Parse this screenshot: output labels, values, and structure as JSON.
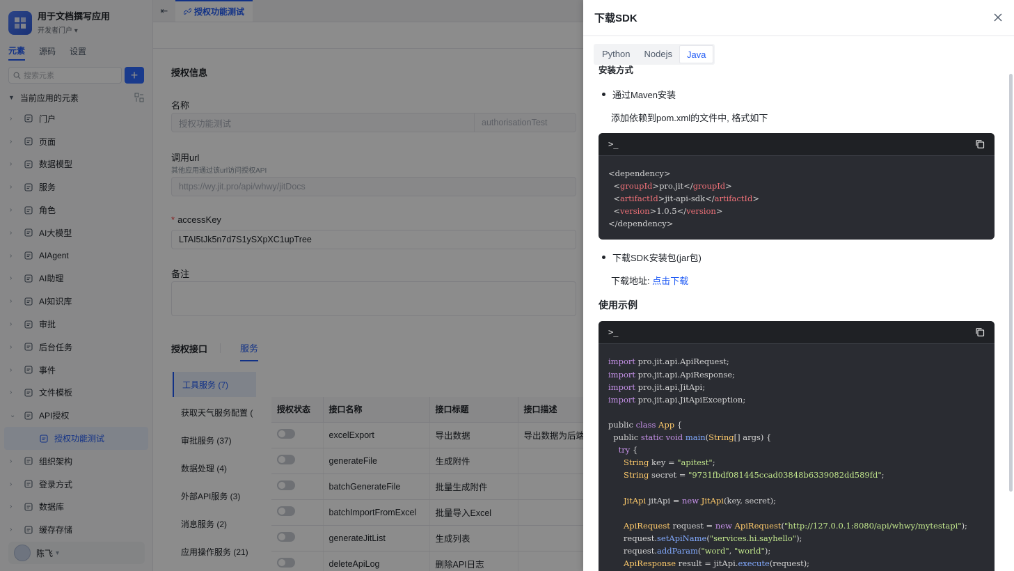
{
  "sidebar": {
    "app_title": "用于文档撰写应用",
    "app_sub": "开发者门户",
    "tabs": [
      "元素",
      "源码",
      "设置"
    ],
    "search_placeholder": "搜索元素",
    "add_label": "+",
    "tree_head": "当前应用的元素",
    "items": [
      {
        "label": "门户",
        "icon": "home-icon"
      },
      {
        "label": "页面",
        "icon": "page-icon"
      },
      {
        "label": "数据模型",
        "icon": "table-icon"
      },
      {
        "label": "服务",
        "icon": "service-icon"
      },
      {
        "label": "角色",
        "icon": "role-icon"
      },
      {
        "label": "AI大模型",
        "icon": "ai-model-icon"
      },
      {
        "label": "AIAgent",
        "icon": "robot-icon"
      },
      {
        "label": "AI助理",
        "icon": "ai-assistant-icon"
      },
      {
        "label": "AI知识库",
        "icon": "book-icon"
      },
      {
        "label": "审批",
        "icon": "stamp-icon"
      },
      {
        "label": "后台任务",
        "icon": "task-icon"
      },
      {
        "label": "事件",
        "icon": "event-icon"
      },
      {
        "label": "文件模板",
        "icon": "file-template-icon"
      },
      {
        "label": "API授权",
        "icon": "link-icon"
      },
      {
        "label": "授权功能测试",
        "icon": "link-icon",
        "sub": true
      },
      {
        "label": "组织架构",
        "icon": "org-icon"
      },
      {
        "label": "登录方式",
        "icon": "login-icon"
      },
      {
        "label": "数据库",
        "icon": "database-icon"
      },
      {
        "label": "缓存存储",
        "icon": "cache-icon"
      }
    ],
    "user_name": "陈飞"
  },
  "main": {
    "tab_label": "授权功能测试",
    "section_title": "授权信息",
    "name_label": "名称",
    "name_value": "授权功能测试",
    "name_id": "authorisationTest",
    "url_label": "调用url",
    "url_hint": "其他应用通过该url访问授权API",
    "url_value": "https://wy.jit.pro/api/whwy/jitDocs",
    "key_label": "accessKey",
    "key_value": "LTAI5tJk5n7d7S1ySXpXC1upTree",
    "remark_label": "备注",
    "subtabs": [
      "授权接口",
      "服务"
    ],
    "services": [
      "工具服务 (7)",
      "获取天气服务配置 (",
      "审批服务 (37)",
      "数据处理 (4)",
      "外部API服务 (3)",
      "消息服务 (2)",
      "应用操作服务 (21)"
    ],
    "table_headers": [
      "授权状态",
      "接口名称",
      "接口标题",
      "接口描述"
    ],
    "table_rows": [
      {
        "name": "excelExport",
        "title": "导出数据",
        "desc": "导出数据为后端"
      },
      {
        "name": "generateFile",
        "title": "生成附件",
        "desc": ""
      },
      {
        "name": "batchGenerateFile",
        "title": "批量生成附件",
        "desc": ""
      },
      {
        "name": "batchImportFromExcel",
        "title": "批量导入Excel",
        "desc": ""
      },
      {
        "name": "generateJitList",
        "title": "生成列表",
        "desc": ""
      },
      {
        "name": "deleteApiLog",
        "title": "删除API日志",
        "desc": ""
      }
    ]
  },
  "drawer": {
    "title": "下载SDK",
    "lang_tabs": [
      "Python",
      "Nodejs",
      "Java"
    ],
    "active_lang": "Java",
    "install_title": "安装方式",
    "bullet1": "通过Maven安装",
    "bullet1_desc": "添加依赖到pom.xml的文件中, 格式如下",
    "prompt": ">_",
    "bullet2": "下载SDK安装包(jar包)",
    "download_prefix": "下载地址: ",
    "download_link": "点击下载",
    "usage_title": "使用示例"
  }
}
